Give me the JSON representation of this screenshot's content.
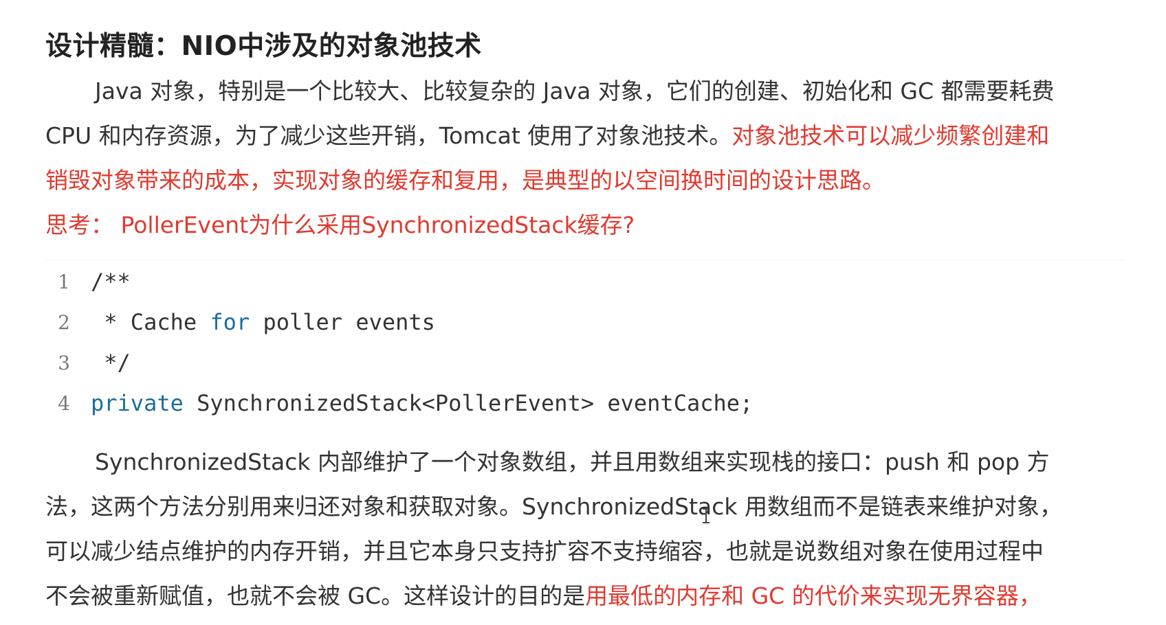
{
  "title": "设计精髓：NIO中涉及的对象池技术",
  "intro": {
    "line1": "Java 对象，特别是一个比较大、比较复杂的 Java 对象，它们的创建、初始化和 GC 都需要耗费",
    "line2_plain": "CPU 和内存资源，为了减少这些开销，Tomcat 使用了对象池技术。",
    "line2_red": "对象池技术可以减少频繁创建和",
    "line3_red": "销毁对象带来的成本，实现对象的缓存和复用，是典型的以空间换时间的设计思路。"
  },
  "question": "思考： PollerEvent为什么采用SynchronizedStack缓存?",
  "code": {
    "lines": [
      {
        "num": "1",
        "text": "/**"
      },
      {
        "num": "2",
        "pre": " * Cache ",
        "kw": "for",
        "post": " poller events"
      },
      {
        "num": "3",
        "text": " */"
      },
      {
        "num": "4",
        "kw": "private",
        "post": " SynchronizedStack<PollerEvent> eventCache;"
      }
    ]
  },
  "body": {
    "line1": "SynchronizedStack 内部维护了一个对象数组，并且用数组来实现栈的接口：push 和 pop 方",
    "line2": "法，这两个方法分别用来归还对象和获取对象。SynchronizedStack 用数组而不是链表来维护对象，",
    "line3": "可以减少结点维护的内存开销，并且它本身只支持扩容不支持缩容，也就是说数组对象在使用过程中",
    "line4_plain": "不会被重新赋值，也就不会被 GC。这样设计的目的是",
    "line4_red": "用最低的内存和 GC 的代价来实现无界容器，"
  },
  "colors": {
    "highlight": "#e03a2f",
    "keyword": "#1b6d9b",
    "text": "#333333"
  }
}
